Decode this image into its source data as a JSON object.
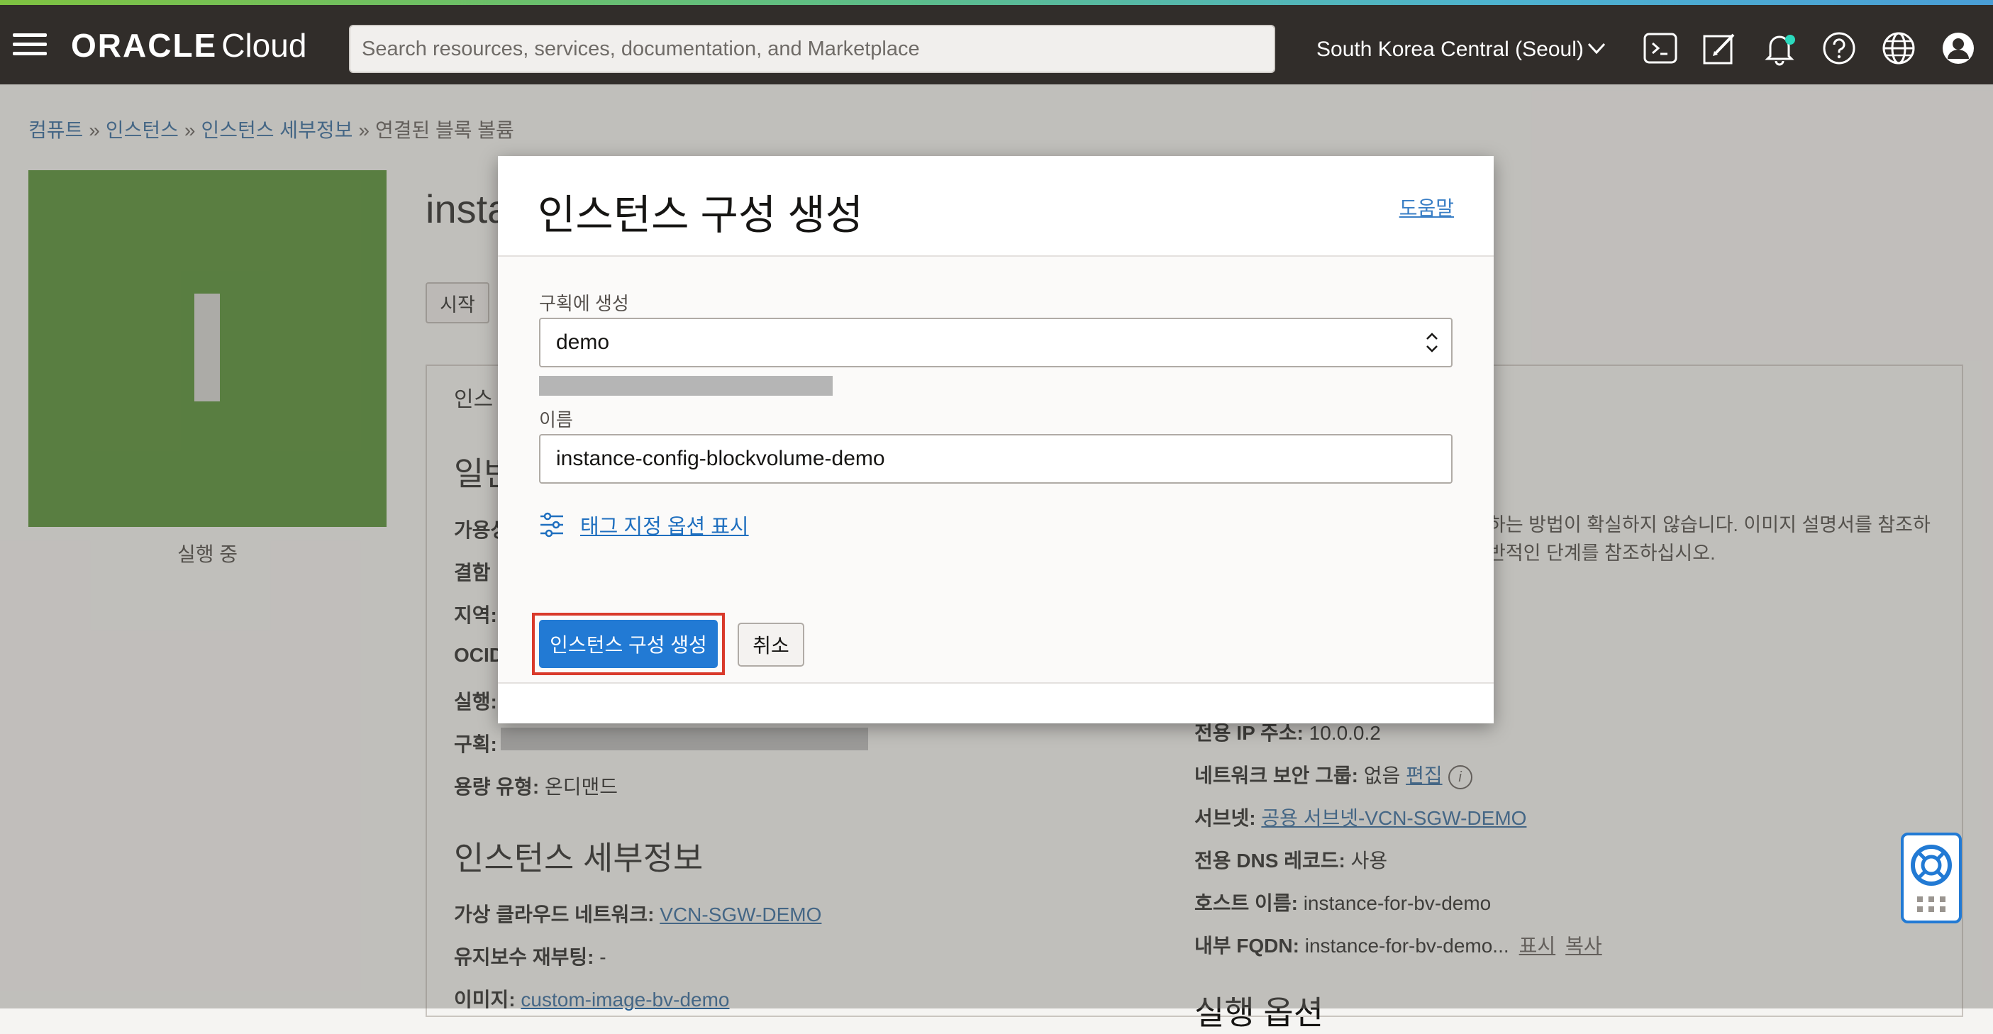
{
  "topbar": {
    "brand_oracle": "ORACLE",
    "brand_cloud": "Cloud",
    "search_placeholder": "Search resources, services, documentation, and Marketplace",
    "region": "South Korea Central (Seoul)",
    "icons": [
      "menu-icon",
      "cloud-shell-icon",
      "edit-icon",
      "bell-icon",
      "help-icon",
      "globe-icon",
      "user-icon"
    ],
    "accent_color": "#312d2a"
  },
  "breadcrumb": {
    "items": [
      "컴퓨트",
      "인스턴스",
      "인스턴스 세부정보"
    ],
    "separator": "»",
    "current": "연결된 블록 볼륨"
  },
  "instance": {
    "title": "insta",
    "status": "실행 중",
    "status_color": "#44851f",
    "start_button": "시작",
    "tab_label": "인스",
    "general_section": "일반",
    "fields": {
      "availability": "가용성",
      "fault": "결함",
      "region": "지역:",
      "ocid": "OCID",
      "launched": "실행:",
      "compartment": "구획:",
      "capacity_label": "용량 유형:",
      "capacity_value": "온디맨드"
    },
    "details_section": "인스턴스 세부정보",
    "vcn_label": "가상 클라우드 네트워크:",
    "vcn_value": "VCN-SGW-DEMO",
    "maintenance_label": "유지보수 재부팅:",
    "maintenance_value": "-",
    "image_label": "이미지:",
    "image_value": "custom-image-bv-demo"
  },
  "right_column": {
    "note_line1": "하는 방법이 확실하지 않습니다. 이미지 설명서를 참조하",
    "note_line2": "반적인 단계를 참조하십시오.",
    "private_ip_label": "전용 IP 주소:",
    "private_ip_value": "10.0.0.2",
    "nsg_label": "네트워크 보안 그룹:",
    "nsg_value": "없음",
    "nsg_edit": "편집",
    "subnet_label": "서브넷:",
    "subnet_value": "공용 서브넷-VCN-SGW-DEMO",
    "dns_label": "전용 DNS 레코드:",
    "dns_value": "사용",
    "hostname_label": "호스트 이름:",
    "hostname_value": "instance-for-bv-demo",
    "fqdn_label": "내부 FQDN:",
    "fqdn_value": "instance-for-bv-demo...",
    "fqdn_show": "표시",
    "fqdn_copy": "복사",
    "run_options_section": "실행 옵션"
  },
  "modal": {
    "title": "인스턴스 구성 생성",
    "help_link": "도움말",
    "compartment_label": "구획에 생성",
    "compartment_value": "demo",
    "name_label": "이름",
    "name_value": "instance-config-blockvolume-demo",
    "tag_link": "태그 지정 옵션 표시",
    "create_button": "인스턴스 구성 생성",
    "cancel_button": "취소",
    "primary_color": "#227ad4",
    "highlight_color": "#d93a2b"
  }
}
